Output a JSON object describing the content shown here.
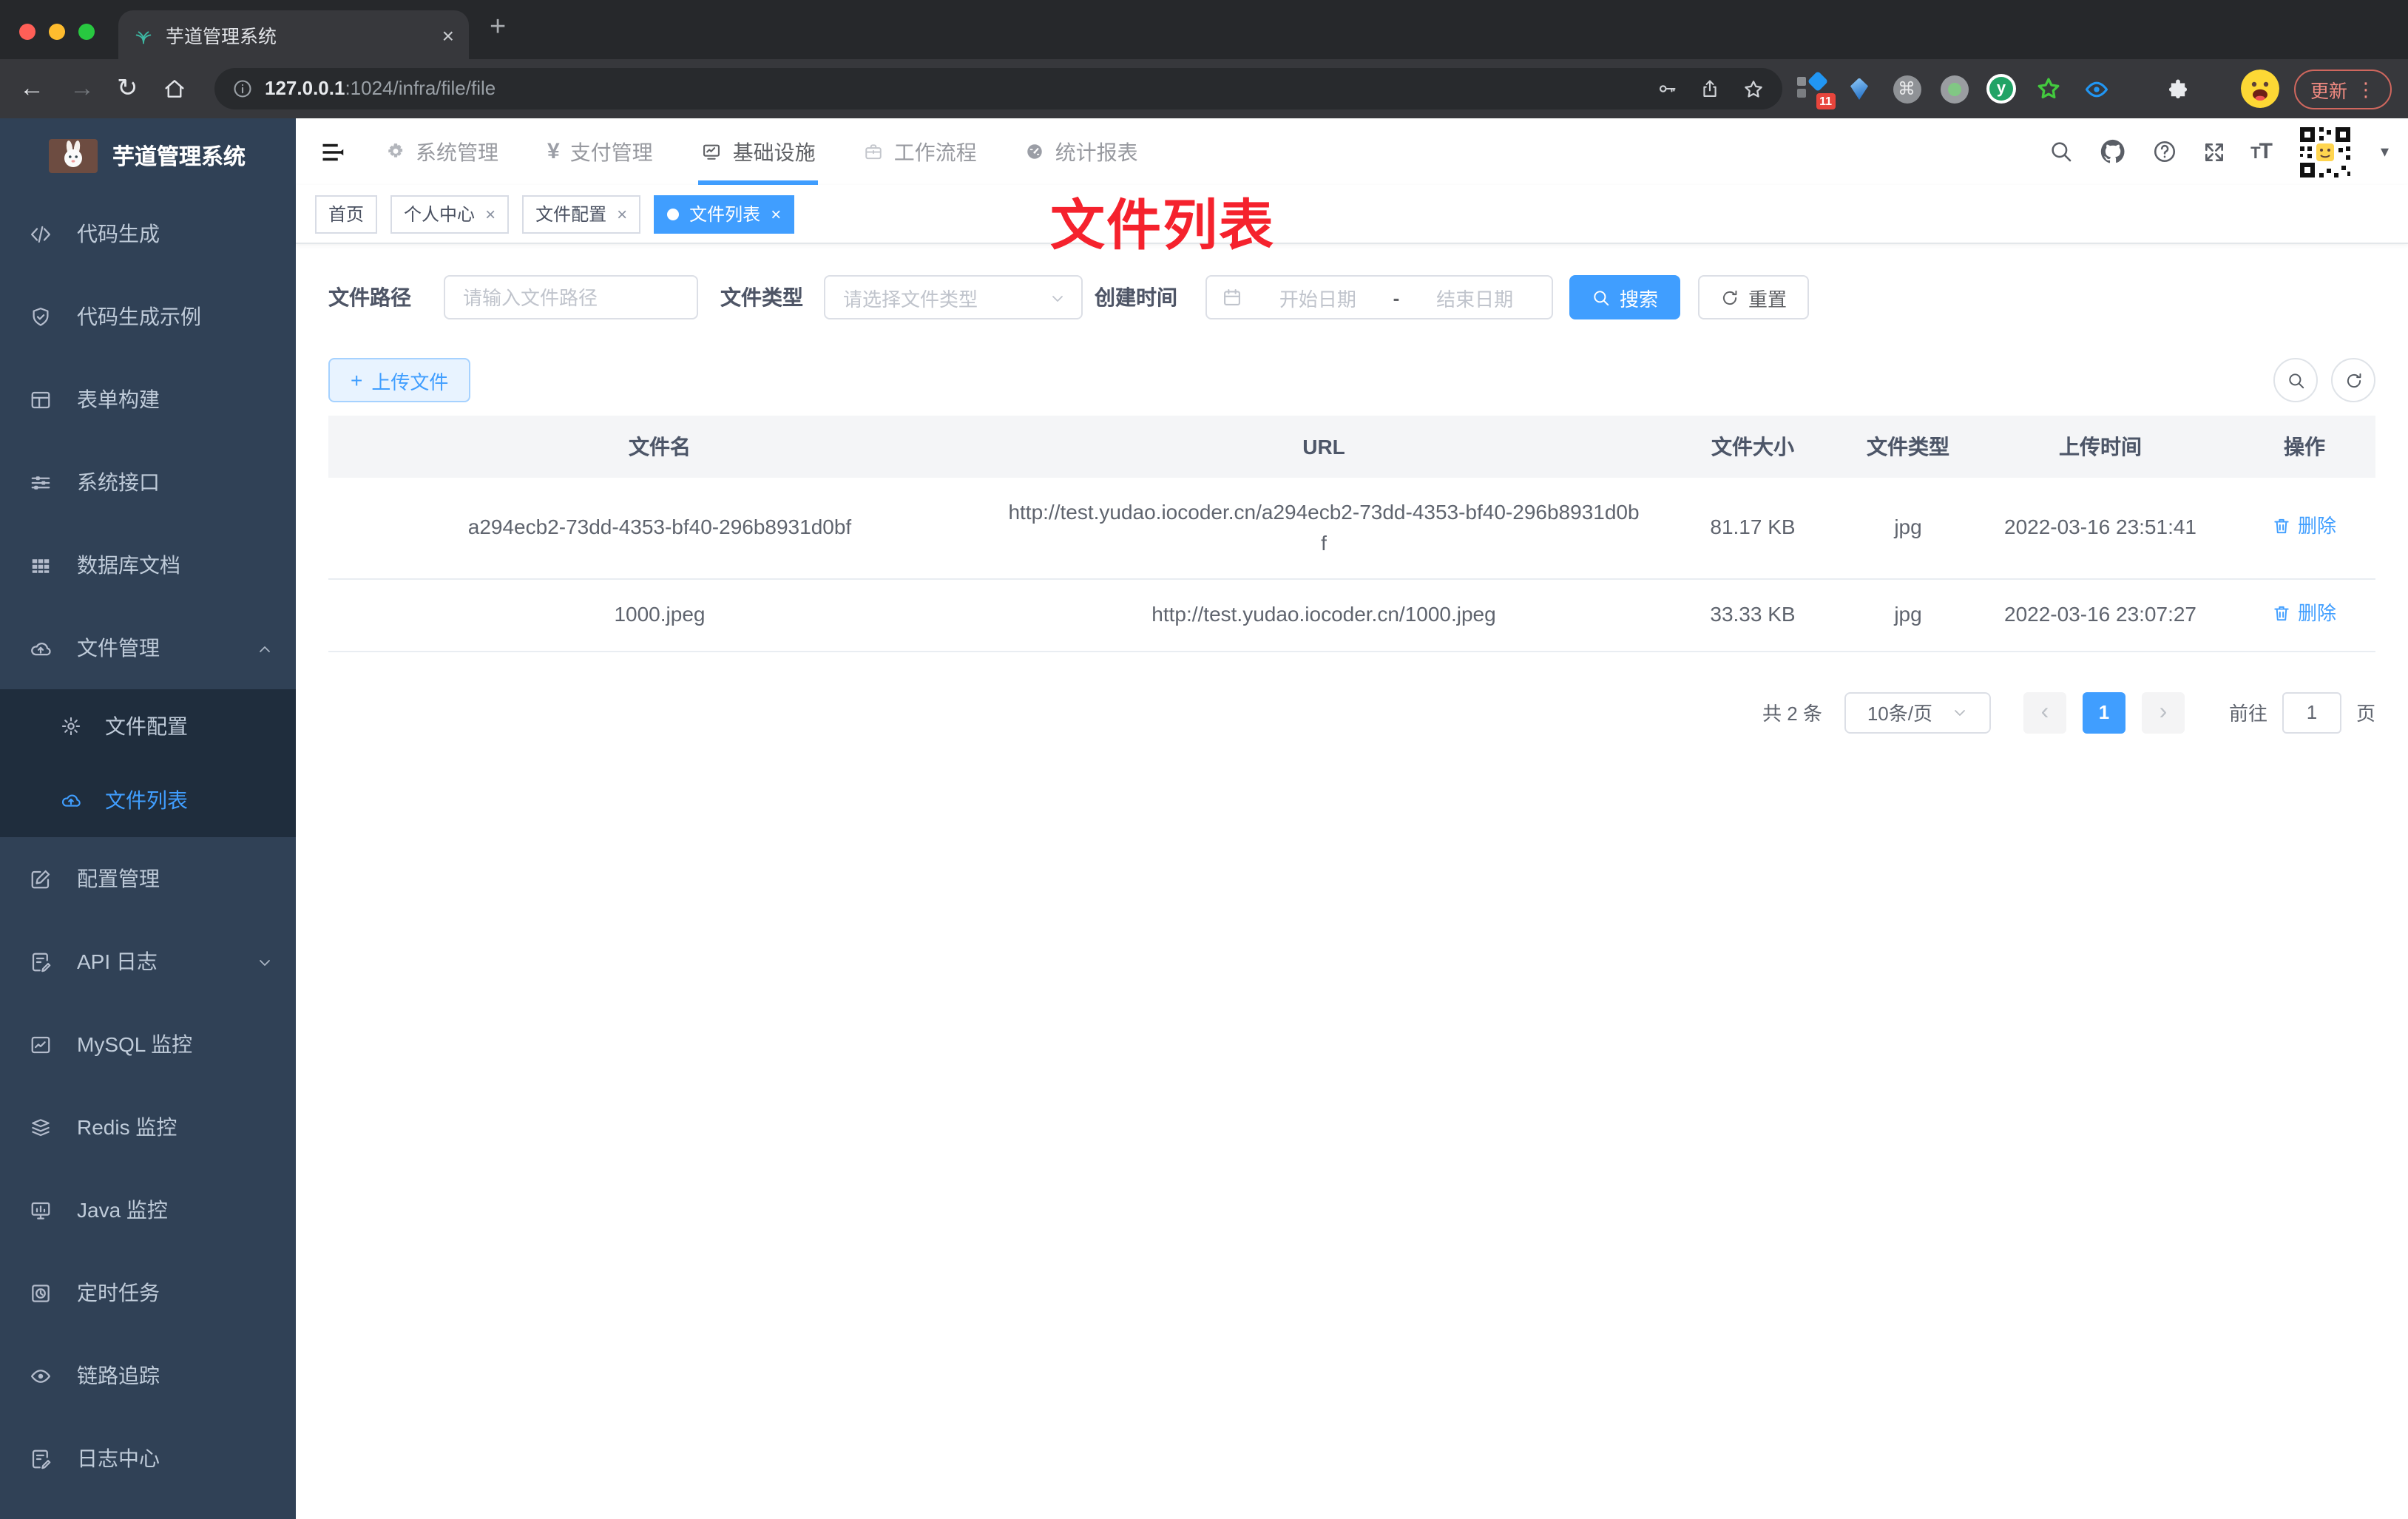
{
  "browser": {
    "tab_title": "芋道管理系统",
    "url_host": "127.0.0.1",
    "url_path": ":1024/infra/file/file",
    "update_label": "更新",
    "extension_badge": "11",
    "extension_y": "y"
  },
  "icons": {
    "close": "×",
    "plus": "+",
    "back": "←",
    "forward": "→",
    "reload": "↻",
    "dots": "⋮",
    "command": "⌘",
    "prev": "‹",
    "next": "›",
    "yen": "¥"
  },
  "sidebar": {
    "app_title": "芋道管理系统",
    "items": [
      {
        "label": "代码生成",
        "icon": "code-icon"
      },
      {
        "label": "代码生成示例",
        "icon": "shield-check-icon"
      },
      {
        "label": "表单构建",
        "icon": "form-icon"
      },
      {
        "label": "系统接口",
        "icon": "sliders-icon"
      },
      {
        "label": "数据库文档",
        "icon": "grid-icon"
      },
      {
        "label": "文件管理",
        "icon": "cloud-upload-icon"
      },
      {
        "label": "文件配置",
        "icon": "gear-icon"
      },
      {
        "label": "文件列表",
        "icon": "cloud-upload-icon"
      },
      {
        "label": "配置管理",
        "icon": "edit-square-icon"
      },
      {
        "label": "API 日志",
        "icon": "doc-edit-icon"
      },
      {
        "label": "MySQL 监控",
        "icon": "chart-box-icon"
      },
      {
        "label": "Redis 监控",
        "icon": "layers-icon"
      },
      {
        "label": "Java 监控",
        "icon": "monitor-icon"
      },
      {
        "label": "定时任务",
        "icon": "timer-icon"
      },
      {
        "label": "链路追踪",
        "icon": "eye-icon"
      },
      {
        "label": "日志中心",
        "icon": "doc-edit-icon"
      }
    ]
  },
  "topnav": {
    "items": [
      {
        "label": "系统管理",
        "icon": "gear-icon"
      },
      {
        "label": "支付管理",
        "icon": "yen-icon"
      },
      {
        "label": "基础设施",
        "icon": "infra-icon"
      },
      {
        "label": "工作流程",
        "icon": "briefcase-icon"
      },
      {
        "label": "统计报表",
        "icon": "gauge-icon"
      }
    ]
  },
  "tags_view": {
    "tags": [
      {
        "label": "首页"
      },
      {
        "label": "个人中心"
      },
      {
        "label": "文件配置"
      },
      {
        "label": "文件列表"
      }
    ]
  },
  "annotation": {
    "text": "文件列表"
  },
  "filters": {
    "path_label": "文件路径",
    "path_placeholder": "请输入文件路径",
    "type_label": "文件类型",
    "type_placeholder": "请选择文件类型",
    "time_label": "创建时间",
    "date_start_placeholder": "开始日期",
    "date_separator": "-",
    "date_end_placeholder": "结束日期",
    "search_label": "搜索",
    "reset_label": "重置"
  },
  "toolbar": {
    "upload_label": "上传文件"
  },
  "table": {
    "columns": [
      "文件名",
      "URL",
      "文件大小",
      "文件类型",
      "上传时间",
      "操作"
    ],
    "delete_label": "删除",
    "rows": [
      {
        "name": "a294ecb2-73dd-4353-bf40-296b8931d0bf",
        "url": "http://test.yudao.iocoder.cn/a294ecb2-73dd-4353-bf40-296b8931d0bf",
        "size": "81.17 KB",
        "type": "jpg",
        "time": "2022-03-16 23:51:41"
      },
      {
        "name": "1000.jpeg",
        "url": "http://test.yudao.iocoder.cn/1000.jpeg",
        "size": "33.33 KB",
        "type": "jpg",
        "time": "2022-03-16 23:07:27"
      }
    ]
  },
  "pagination": {
    "total": "共 2 条",
    "page_size": "10条/页",
    "page": "1",
    "goto_label": "前往",
    "goto_value": "1",
    "unit": "页"
  },
  "colors": {
    "primary": "#409eff",
    "sidebar_bg": "#304156",
    "submenu_bg": "#1f2d3d",
    "annotation_red": "#f5222d"
  }
}
